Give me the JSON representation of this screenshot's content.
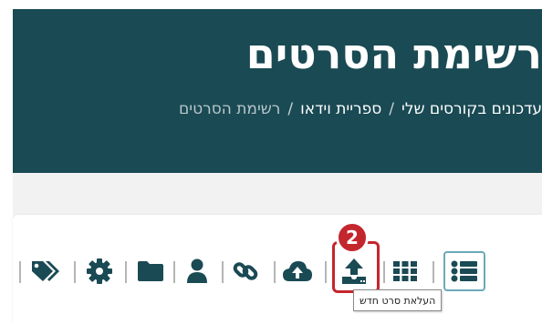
{
  "header": {
    "title": "רשימת הסרטים",
    "breadcrumb": {
      "items": [
        "עדכונים בקורסים שלי",
        "ספריית וידאו"
      ],
      "separator": "/",
      "current": "רשימת הסרטים"
    }
  },
  "toolbar": {
    "icons": [
      "tags-icon",
      "gear-icon",
      "folder-icon",
      "user-icon",
      "link-icon",
      "cloud-upload-icon",
      "upload-new-video-icon",
      "grid-view-icon",
      "list-view-icon"
    ],
    "active": "list-view-icon",
    "tooltip": "העלאת סרט חדש"
  },
  "annotation": {
    "step_number": "2"
  },
  "colors": {
    "header_bg": "#1a4a54",
    "icon": "#1a4a54",
    "highlight": "#c4262e"
  }
}
